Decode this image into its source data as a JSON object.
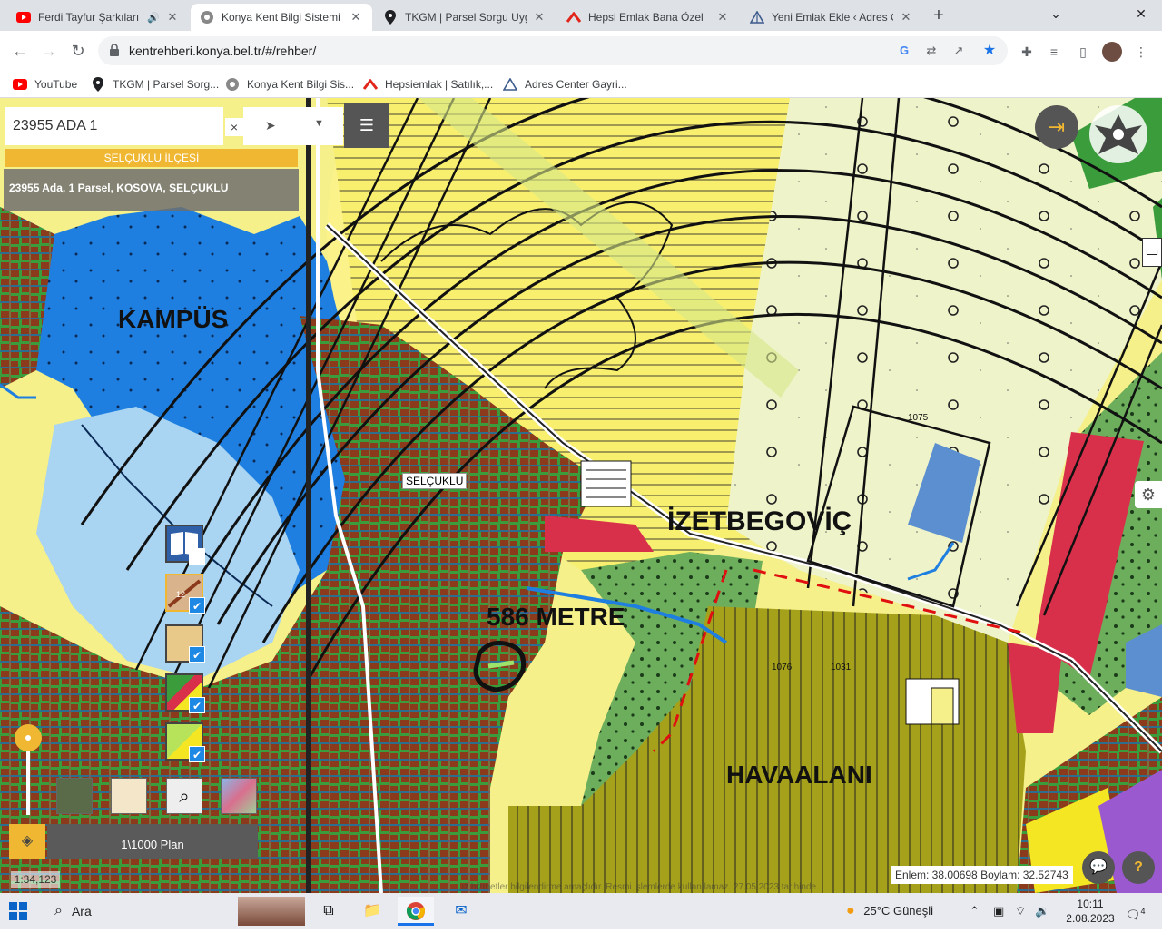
{
  "browser": {
    "tabs": [
      {
        "label": "Ferdi Tayfur Şarkıları En",
        "icon": "youtube-icon",
        "active": false
      },
      {
        "label": "Konya Kent Bilgi Sistemi",
        "icon": "konya-logo-icon",
        "active": true
      },
      {
        "label": "TKGM | Parsel Sorgu Uygu",
        "icon": "location-pin-icon",
        "active": false
      },
      {
        "label": "Hepsi Emlak Bana Özel",
        "icon": "hepsiemlak-icon",
        "active": false
      },
      {
        "label": "Yeni Emlak Ekle ‹ Adres C",
        "icon": "adres-center-icon",
        "active": false
      }
    ],
    "new_tab": "+",
    "window_controls": {
      "minimize": "⌄",
      "restore": "—",
      "maximize": "❐",
      "close": "✕"
    },
    "url": "kentrehberi.konya.bel.tr/#/rehber/",
    "bookmarks": [
      {
        "label": "YouTube",
        "icon": "youtube-icon"
      },
      {
        "label": "TKGM | Parsel Sorg...",
        "icon": "location-pin-icon"
      },
      {
        "label": "Konya Kent Bilgi Sis...",
        "icon": "konya-logo-icon"
      },
      {
        "label": "Hepsiemlak | Satılık,...",
        "icon": "hepsiemlak-icon"
      },
      {
        "label": "Adres Center Gayri...",
        "icon": "adres-center-icon"
      }
    ],
    "colors": {
      "tabbar": "#dee1e6",
      "accent": "#1a73e8"
    }
  },
  "map": {
    "search_value": "23955 ADA 1",
    "search_clear": "×",
    "district": "SELÇUKLU İLÇESİ",
    "result": "23955 Ada, 1 Parsel, KOSOVA, SELÇUKLU",
    "labels": {
      "kampus": "KAMPÜS",
      "izetbegovic": "İZETBEGOVİÇ",
      "metre": "586 METRE",
      "havaalani": "HAVAALANI",
      "selcuklu": "SELÇUKLU"
    },
    "plan_label": "1\\1000 Plan",
    "scale": "1:34,123",
    "coords": "Enlem: 38.00698 Boylam: 32.52743",
    "disclaimer": "...ız hizmetler bilgilendirme amaçlıdır. Resmi işlemlerde kullanılamaz. 27.05.2023 tarihinde...",
    "contour_labels": [
      "1075",
      "1031",
      "1076"
    ],
    "colors": {
      "accent": "#f0b732",
      "yellow_zone": "#f5f08a",
      "blue_zone": "#1e7fe0",
      "residential": "#8b3a1c",
      "green_zone": "#3b9c3b",
      "red_zone": "#d8304a",
      "olive_zone": "#a6a11a"
    }
  },
  "taskbar": {
    "search_placeholder": "Ara",
    "weather": "25°C  Güneşli",
    "time": "10:11",
    "date": "2.08.2023",
    "notifications": "4"
  }
}
